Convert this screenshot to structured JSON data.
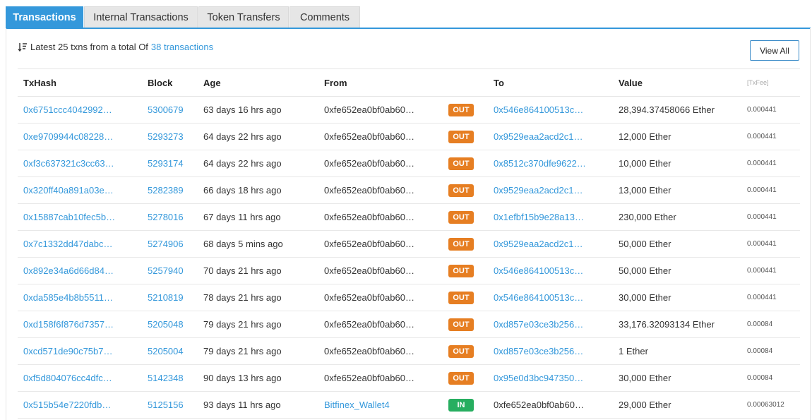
{
  "tabs": [
    {
      "label": "Transactions",
      "active": true
    },
    {
      "label": "Internal Transactions",
      "active": false
    },
    {
      "label": "Token Transfers",
      "active": false
    },
    {
      "label": "Comments",
      "active": false
    }
  ],
  "summary": {
    "icon": "sort-icon",
    "prefix": "Latest 25 txns from a total Of",
    "link": "38 transactions"
  },
  "view_all_label": "View All",
  "columns": {
    "txhash": "TxHash",
    "block": "Block",
    "age": "Age",
    "from": "From",
    "to": "To",
    "value": "Value",
    "fee": "[TxFee]"
  },
  "colors": {
    "accent": "#3498db",
    "out": "#e67e22",
    "in": "#27ae60"
  },
  "rows": [
    {
      "hash": "0x6751ccc4042992…",
      "block": "5300679",
      "age": "63 days 16 hrs ago",
      "from": "0xfe652ea0bf0ab60…",
      "from_link": false,
      "dir": "OUT",
      "to": "0x546e864100513c…",
      "to_link": true,
      "value": "28,394.37458066 Ether",
      "fee": "0.000441"
    },
    {
      "hash": "0xe9709944c08228…",
      "block": "5293273",
      "age": "64 days 22 hrs ago",
      "from": "0xfe652ea0bf0ab60…",
      "from_link": false,
      "dir": "OUT",
      "to": "0x9529eaa2acd2c1…",
      "to_link": true,
      "value": "12,000 Ether",
      "fee": "0.000441"
    },
    {
      "hash": "0xf3c637321c3cc63…",
      "block": "5293174",
      "age": "64 days 22 hrs ago",
      "from": "0xfe652ea0bf0ab60…",
      "from_link": false,
      "dir": "OUT",
      "to": "0x8512c370dfe9622…",
      "to_link": true,
      "value": "10,000 Ether",
      "fee": "0.000441"
    },
    {
      "hash": "0x320ff40a891a03e…",
      "block": "5282389",
      "age": "66 days 18 hrs ago",
      "from": "0xfe652ea0bf0ab60…",
      "from_link": false,
      "dir": "OUT",
      "to": "0x9529eaa2acd2c1…",
      "to_link": true,
      "value": "13,000 Ether",
      "fee": "0.000441"
    },
    {
      "hash": "0x15887cab10fec5b…",
      "block": "5278016",
      "age": "67 days 11 hrs ago",
      "from": "0xfe652ea0bf0ab60…",
      "from_link": false,
      "dir": "OUT",
      "to": "0x1efbf15b9e28a13…",
      "to_link": true,
      "value": "230,000 Ether",
      "fee": "0.000441"
    },
    {
      "hash": "0x7c1332dd47dabc…",
      "block": "5274906",
      "age": "68 days 5 mins ago",
      "from": "0xfe652ea0bf0ab60…",
      "from_link": false,
      "dir": "OUT",
      "to": "0x9529eaa2acd2c1…",
      "to_link": true,
      "value": "50,000 Ether",
      "fee": "0.000441"
    },
    {
      "hash": "0x892e34a6d66d84…",
      "block": "5257940",
      "age": "70 days 21 hrs ago",
      "from": "0xfe652ea0bf0ab60…",
      "from_link": false,
      "dir": "OUT",
      "to": "0x546e864100513c…",
      "to_link": true,
      "value": "50,000 Ether",
      "fee": "0.000441"
    },
    {
      "hash": "0xda585e4b8b5511…",
      "block": "5210819",
      "age": "78 days 21 hrs ago",
      "from": "0xfe652ea0bf0ab60…",
      "from_link": false,
      "dir": "OUT",
      "to": "0x546e864100513c…",
      "to_link": true,
      "value": "30,000 Ether",
      "fee": "0.000441"
    },
    {
      "hash": "0xd158f6f876d7357…",
      "block": "5205048",
      "age": "79 days 21 hrs ago",
      "from": "0xfe652ea0bf0ab60…",
      "from_link": false,
      "dir": "OUT",
      "to": "0xd857e03ce3b256…",
      "to_link": true,
      "value": "33,176.32093134 Ether",
      "fee": "0.00084"
    },
    {
      "hash": "0xcd571de90c75b7…",
      "block": "5205004",
      "age": "79 days 21 hrs ago",
      "from": "0xfe652ea0bf0ab60…",
      "from_link": false,
      "dir": "OUT",
      "to": "0xd857e03ce3b256…",
      "to_link": true,
      "value": "1 Ether",
      "fee": "0.00084"
    },
    {
      "hash": "0xf5d804076cc4dfc…",
      "block": "5142348",
      "age": "90 days 13 hrs ago",
      "from": "0xfe652ea0bf0ab60…",
      "from_link": false,
      "dir": "OUT",
      "to": "0x95e0d3bc947350…",
      "to_link": true,
      "value": "30,000 Ether",
      "fee": "0.00084"
    },
    {
      "hash": "0x515b54e7220fdb…",
      "block": "5125156",
      "age": "93 days 11 hrs ago",
      "from": "Bitfinex_Wallet4",
      "from_link": true,
      "dir": "IN",
      "to": "0xfe652ea0bf0ab60…",
      "to_link": false,
      "value": "29,000 Ether",
      "fee": "0.00063012"
    }
  ]
}
